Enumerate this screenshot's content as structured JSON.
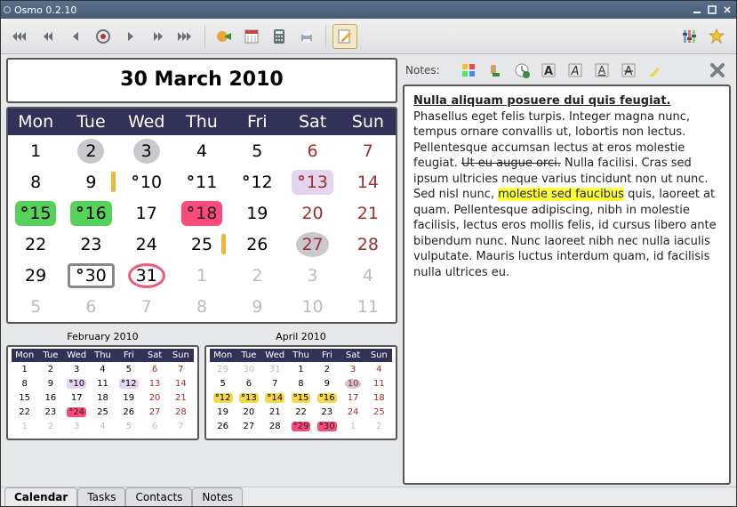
{
  "window": {
    "title": "Osmo 0.2.10"
  },
  "calendar": {
    "title": "30 March 2010",
    "dow": [
      "Mon",
      "Tue",
      "Wed",
      "Thu",
      "Fri",
      "Sat",
      "Sun"
    ],
    "days": [
      {
        "n": "1"
      },
      {
        "n": "2",
        "hl": "gray-circle"
      },
      {
        "n": "3",
        "hl": "gray-circle"
      },
      {
        "n": "4"
      },
      {
        "n": "5"
      },
      {
        "n": "6",
        "weekend": true
      },
      {
        "n": "7",
        "weekend": true
      },
      {
        "n": "8"
      },
      {
        "n": "9",
        "bar": true
      },
      {
        "n": "10",
        "note": true
      },
      {
        "n": "11",
        "note": true
      },
      {
        "n": "12",
        "note": true
      },
      {
        "n": "13",
        "note": true,
        "hl": "hl-lav",
        "weekend": true
      },
      {
        "n": "14",
        "weekend": true
      },
      {
        "n": "15",
        "note": true,
        "hl": "hl-green"
      },
      {
        "n": "16",
        "note": true,
        "hl": "hl-green"
      },
      {
        "n": "17"
      },
      {
        "n": "18",
        "note": true,
        "hl": "hl-pink"
      },
      {
        "n": "19"
      },
      {
        "n": "20",
        "weekend": true
      },
      {
        "n": "21",
        "weekend": true
      },
      {
        "n": "22"
      },
      {
        "n": "23"
      },
      {
        "n": "24"
      },
      {
        "n": "25",
        "bar": true
      },
      {
        "n": "26"
      },
      {
        "n": "27",
        "hl": "gray-circle",
        "weekend": true
      },
      {
        "n": "28",
        "weekend": true
      },
      {
        "n": "29"
      },
      {
        "n": "30",
        "note": true,
        "today": true
      },
      {
        "n": "31",
        "circle": true
      },
      {
        "n": "1",
        "other": true
      },
      {
        "n": "2",
        "other": true
      },
      {
        "n": "3",
        "other": true,
        "weekend": true
      },
      {
        "n": "4",
        "other": true,
        "weekend": true
      },
      {
        "n": "5",
        "other": true
      },
      {
        "n": "6",
        "other": true
      },
      {
        "n": "7",
        "other": true
      },
      {
        "n": "8",
        "other": true
      },
      {
        "n": "9",
        "other": true
      },
      {
        "n": "10",
        "other": true,
        "weekend": true
      },
      {
        "n": "11",
        "other": true,
        "weekend": true
      }
    ]
  },
  "mini_prev": {
    "title": "February 2010",
    "dow": [
      "Mon",
      "Tue",
      "Wed",
      "Thu",
      "Fri",
      "Sat",
      "Sun"
    ],
    "days": [
      {
        "n": "1"
      },
      {
        "n": "2"
      },
      {
        "n": "3"
      },
      {
        "n": "4"
      },
      {
        "n": "5"
      },
      {
        "n": "6",
        "weekend": true
      },
      {
        "n": "7",
        "weekend": true
      },
      {
        "n": "8"
      },
      {
        "n": "9"
      },
      {
        "n": "10",
        "note": true,
        "hl": "hl-lav"
      },
      {
        "n": "11"
      },
      {
        "n": "12",
        "note": true,
        "hl": "hl-lav"
      },
      {
        "n": "13",
        "weekend": true
      },
      {
        "n": "14",
        "weekend": true
      },
      {
        "n": "15"
      },
      {
        "n": "16"
      },
      {
        "n": "17"
      },
      {
        "n": "18"
      },
      {
        "n": "19"
      },
      {
        "n": "20",
        "weekend": true
      },
      {
        "n": "21",
        "weekend": true
      },
      {
        "n": "22"
      },
      {
        "n": "23"
      },
      {
        "n": "24",
        "note": true,
        "hl": "hl-pink"
      },
      {
        "n": "25"
      },
      {
        "n": "26"
      },
      {
        "n": "27",
        "weekend": true
      },
      {
        "n": "28",
        "weekend": true
      },
      {
        "n": "1",
        "other": true
      },
      {
        "n": "2",
        "other": true
      },
      {
        "n": "3",
        "other": true
      },
      {
        "n": "4",
        "other": true
      },
      {
        "n": "5",
        "other": true
      },
      {
        "n": "6",
        "other": true,
        "weekend": true
      },
      {
        "n": "7",
        "other": true,
        "weekend": true
      }
    ]
  },
  "mini_next": {
    "title": "April 2010",
    "dow": [
      "Mon",
      "Tue",
      "Wed",
      "Thu",
      "Fri",
      "Sat",
      "Sun"
    ],
    "days": [
      {
        "n": "29",
        "other": true
      },
      {
        "n": "30",
        "other": true
      },
      {
        "n": "31",
        "other": true
      },
      {
        "n": "1"
      },
      {
        "n": "2"
      },
      {
        "n": "3",
        "weekend": true
      },
      {
        "n": "4",
        "weekend": true
      },
      {
        "n": "5"
      },
      {
        "n": "6"
      },
      {
        "n": "7"
      },
      {
        "n": "8"
      },
      {
        "n": "9"
      },
      {
        "n": "10",
        "hl": "hl-gray",
        "weekend": true
      },
      {
        "n": "11",
        "weekend": true
      },
      {
        "n": "12",
        "note": true,
        "hl": "hl-yell"
      },
      {
        "n": "13",
        "note": true,
        "hl": "hl-yell"
      },
      {
        "n": "14",
        "note": true,
        "hl": "hl-yell"
      },
      {
        "n": "15",
        "note": true,
        "hl": "hl-yell"
      },
      {
        "n": "16",
        "note": true,
        "hl": "hl-yell"
      },
      {
        "n": "17",
        "weekend": true
      },
      {
        "n": "18",
        "weekend": true
      },
      {
        "n": "19"
      },
      {
        "n": "20"
      },
      {
        "n": "21"
      },
      {
        "n": "22"
      },
      {
        "n": "23"
      },
      {
        "n": "24",
        "weekend": true
      },
      {
        "n": "25",
        "weekend": true
      },
      {
        "n": "26"
      },
      {
        "n": "27"
      },
      {
        "n": "28"
      },
      {
        "n": "29",
        "note": true,
        "hl": "hl-pink"
      },
      {
        "n": "30",
        "note": true,
        "hl": "hl-pink"
      },
      {
        "n": "1",
        "other": true,
        "weekend": true
      },
      {
        "n": "2",
        "other": true,
        "weekend": true
      }
    ]
  },
  "notes": {
    "label": "Notes:",
    "title": "Nulla aliquam posuere dui quis feugiat.",
    "p1a": "Phasellus eget felis turpis. Integer magna nunc, tempus ornare convallis ut, lobortis non lectus. Pellentesque accumsan lectus at eros molestie feugiat. ",
    "strike": "Ut eu augue orci.",
    "p1b": " Nulla facilisi. Cras sed ipsum ultricies neque varius tincidunt non ut nunc. Sed nisl nunc, ",
    "hl": "molestie sed faucibus",
    "p1c": " quis, laoreet at quam. Pellentesque adipiscing, nibh in molestie facilisis, lectus eros mollis felis, id cursus libero ante bibendum nunc. Nunc laoreet nibh nec nulla iaculis vulputate. Mauris luctus interdum quam, id facilisis nulla ultrices eu."
  },
  "tabs": [
    "Calendar",
    "Tasks",
    "Contacts",
    "Notes"
  ]
}
